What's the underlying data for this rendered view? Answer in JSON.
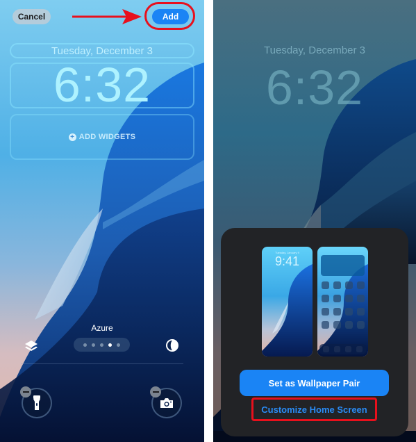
{
  "left_screen": {
    "cancel_label": "Cancel",
    "add_label": "Add",
    "date": "Tuesday, December 3",
    "time": "6:32",
    "add_widgets_label": "ADD WIDGETS",
    "wallpaper_style_name": "Azure",
    "page_dots": {
      "count": 5,
      "active_index": 3
    },
    "icons": {
      "layers": "layers-icon",
      "color_filter": "color-filter-icon",
      "flashlight": "flashlight-icon",
      "camera": "camera-icon",
      "remove": "minus-circle-icon"
    },
    "annotation": {
      "arrow_color": "#e8101c",
      "highlight_color": "#e8101c"
    }
  },
  "right_screen": {
    "date": "Tuesday, December 3",
    "time": "6:32",
    "sheet": {
      "preview_lock": {
        "date": "Tuesday, January 9",
        "time": "9:41"
      },
      "preview_home_icon_rows": 4,
      "preview_home_icon_cols": 4,
      "primary_button_label": "Set as Wallpaper Pair",
      "secondary_button_label": "Customize Home Screen"
    },
    "annotation": {
      "highlight_color": "#e8101c"
    }
  },
  "colors": {
    "accent_blue": "#1a84f5",
    "link_blue": "#2a8cf6",
    "sheet_bg": "#222326",
    "annotation_red": "#e8101c"
  }
}
